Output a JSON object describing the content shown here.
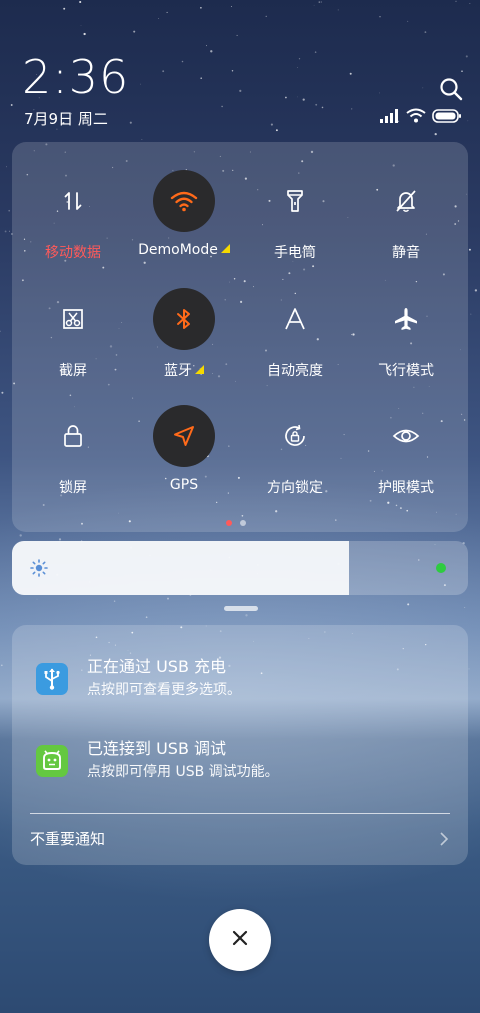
{
  "status": {
    "time": "2:36",
    "date": "7月9日 周二"
  },
  "quick_settings": {
    "tiles": [
      {
        "label": "移动数据",
        "icon": "mobile-data-icon",
        "active": false,
        "label_color": "#ff5a5a"
      },
      {
        "label": "DemoMode",
        "icon": "wifi-icon",
        "active": true,
        "has_more": true
      },
      {
        "label": "手电筒",
        "icon": "flashlight-icon",
        "active": false
      },
      {
        "label": "静音",
        "icon": "mute-bell-icon",
        "active": false
      },
      {
        "label": "截屏",
        "icon": "screenshot-icon",
        "active": false
      },
      {
        "label": "蓝牙",
        "icon": "bluetooth-icon",
        "active": true,
        "has_more": true
      },
      {
        "label": "自动亮度",
        "icon": "auto-brightness-icon",
        "active": false
      },
      {
        "label": "飞行模式",
        "icon": "airplane-icon",
        "active": false
      },
      {
        "label": "锁屏",
        "icon": "lock-icon",
        "active": false
      },
      {
        "label": "GPS",
        "icon": "gps-icon",
        "active": true
      },
      {
        "label": "方向锁定",
        "icon": "rotation-lock-icon",
        "active": false
      },
      {
        "label": "护眼模式",
        "icon": "eye-icon",
        "active": false
      }
    ],
    "page_count": 2,
    "current_page": 1
  },
  "brightness": {
    "level": 0.74
  },
  "notifications": [
    {
      "title": "正在通过 USB 充电",
      "subtitle": "点按即可查看更多选项。",
      "icon": "usb-icon",
      "icon_color": "#3b9be0"
    },
    {
      "title": "已连接到 USB 调试",
      "subtitle": "点按即可停用 USB 调试功能。",
      "icon": "android-debug-icon",
      "icon_color": "#64c840"
    }
  ],
  "unimportant_label": "不重要通知",
  "colors": {
    "accent_active": "#ff6a1a",
    "active_bg": "#2a2a2c",
    "alert_red": "#ff5a5a",
    "brightness_dot": "#2ecc40"
  }
}
